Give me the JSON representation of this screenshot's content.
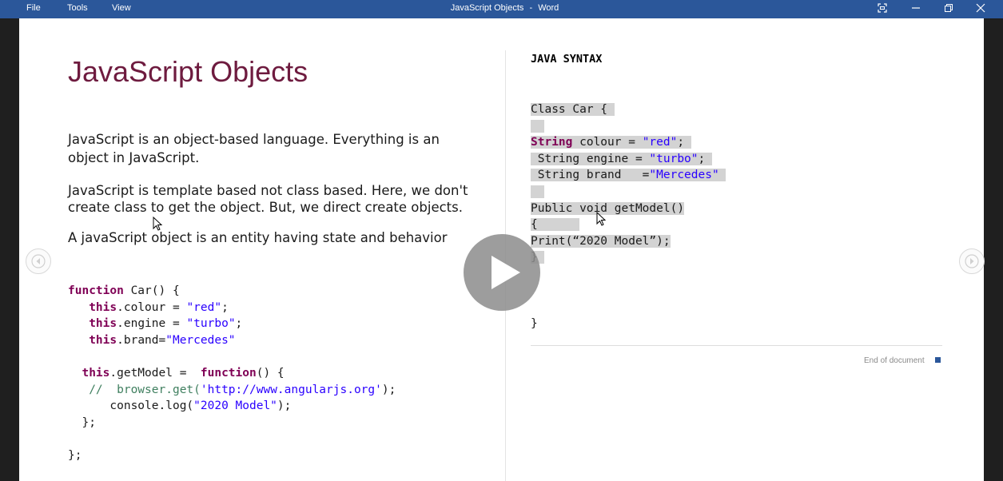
{
  "titlebar": {
    "menu": [
      "File",
      "Tools",
      "View"
    ],
    "window_title": "JavaScript Objects",
    "app_name": "Word",
    "separator": "-"
  },
  "document": {
    "heading": "JavaScript Objects",
    "paragraphs": [
      "JavaScript is an object-based language. Everything is an",
      "object in JavaScript.",
      "JavaScript is template based not class based. Here, we don't",
      "create class to get the object. But, we direct create objects.",
      "A javaScript object is an entity having state and behavior"
    ],
    "js_code": {
      "line1_kw": "function",
      "line1_rest": " Car() {",
      "line2_kw": "this",
      "line2_mid": ".colour = ",
      "line2_str": "\"red\"",
      "line2_end": ";",
      "line3_kw": "this",
      "line3_mid": ".engine = ",
      "line3_str": "\"turbo\"",
      "line3_end": ";",
      "line4_kw": "this",
      "line4_mid": ".brand=",
      "line4_str": "\"Mercedes\"",
      "line5_kw": "this",
      "line5_mid": ".getModel =  ",
      "line5_kw2": "function",
      "line5_end": "() {",
      "line6_comment": "//  browser.get(",
      "line6_str": "'http://www.angularjs.org'",
      "line6_end": ");",
      "line7_pre": "console.log(",
      "line7_str": "\"2020 Model\"",
      "line7_end": ");",
      "line8": "};",
      "line9": "};"
    },
    "java_title": "JAVA SYNTAX",
    "java_code": {
      "line1": "Class Car { ",
      "line2_kw": "String",
      "line2_mid": " colour = ",
      "line2_str": "\"red\"",
      "line2_end": ";",
      "line3_pre": " String engine = ",
      "line3_str": "\"turbo\"",
      "line3_end": ";",
      "line4_pre": " String brand   =",
      "line4_str": "\"Mercedes\"",
      "line5": "Public void getModel()",
      "line6": "{",
      "line7": "Print(“2020 Model”);",
      "line8": "}",
      "line9": "}"
    },
    "end_of_document": "End of document"
  },
  "colors": {
    "titlebar": "#2b579a",
    "heading": "#6e1b3f",
    "keyword": "#7f0055",
    "string": "#2a00ff",
    "comment": "#3f7f5f",
    "selection": "#d3d3d3"
  },
  "icons": {
    "play": "play-icon",
    "prev": "chevron-left-icon",
    "next": "chevron-right-icon",
    "focus": "focus-mode-icon",
    "minimize": "minimize-icon",
    "restore": "restore-icon",
    "close": "close-icon"
  }
}
